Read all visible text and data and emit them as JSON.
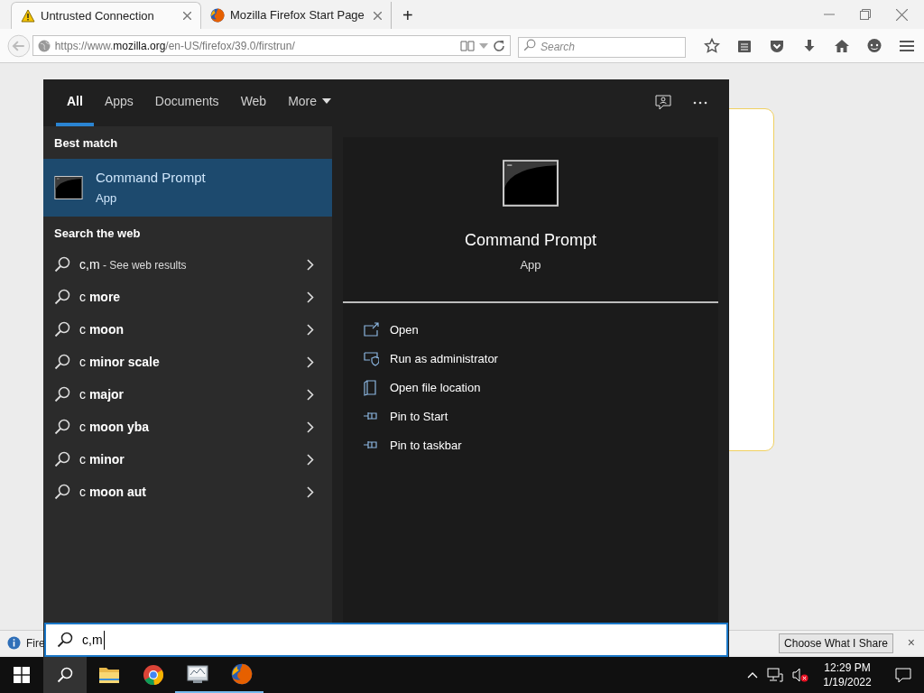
{
  "browser": {
    "tabs": [
      {
        "title": "Untrusted Connection",
        "kind": "warning",
        "selected": true
      },
      {
        "title": "Mozilla Firefox Start Page",
        "kind": "firefox",
        "selected": false
      }
    ],
    "new_tab": "+",
    "url": {
      "prefix": "https://www.",
      "domain": "mozilla.org",
      "path": "/en-US/firefox/39.0/firstrun/"
    },
    "search": {
      "placeholder": "Search"
    },
    "notification": {
      "text": "Fire",
      "button": "Choose What I Share",
      "close": "×"
    }
  },
  "start_menu": {
    "filters": [
      {
        "label": "All",
        "selected": true
      },
      {
        "label": "Apps",
        "selected": false
      },
      {
        "label": "Documents",
        "selected": false
      },
      {
        "label": "Web",
        "selected": false
      },
      {
        "label": "More",
        "selected": false,
        "dropdown": true
      }
    ],
    "best_match_heading": "Best match",
    "best_match": {
      "name": "Command Prompt",
      "type": "App",
      "selected": true
    },
    "web_heading": "Search the web",
    "web_results": [
      {
        "text": "c,m",
        "note": "- See web results"
      },
      {
        "text": "c **more**"
      },
      {
        "text": "c **moon**"
      },
      {
        "text": "c **minor scale**"
      },
      {
        "text": "c **major**"
      },
      {
        "text": "c **moon yba**"
      },
      {
        "text": "c **minor**"
      },
      {
        "text": "c **moon aut**"
      }
    ],
    "preview": {
      "name": "Command Prompt",
      "type": "App",
      "actions": [
        {
          "label": "Open",
          "kind": "open"
        },
        {
          "label": "Run as administrator",
          "kind": "shield"
        },
        {
          "label": "Open file location",
          "kind": "folder"
        },
        {
          "label": "Pin to Start",
          "kind": "pin"
        },
        {
          "label": "Pin to taskbar",
          "kind": "pin"
        }
      ]
    },
    "query": "c,m"
  },
  "taskbar": {
    "apps": [
      {
        "kind": "explorer",
        "running": false
      },
      {
        "kind": "chrome",
        "running": false
      },
      {
        "kind": "server",
        "running": true
      },
      {
        "kind": "firefox",
        "running": true
      }
    ],
    "time": "12:29 PM",
    "date": "1/19/2022"
  }
}
